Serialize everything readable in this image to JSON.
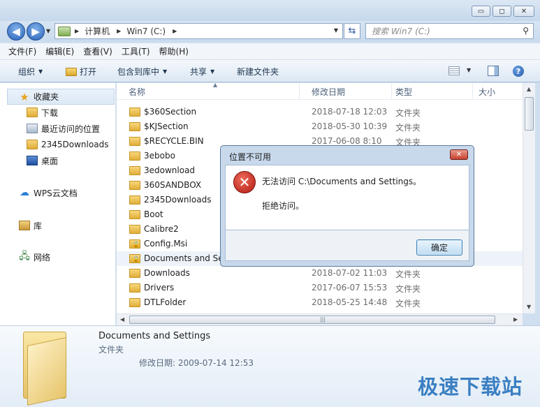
{
  "window": {
    "controls": {
      "minimize": "▭",
      "maximize": "◻",
      "close": "✕"
    }
  },
  "address": {
    "crumbs": [
      "计算机",
      "Win7 (C:)"
    ],
    "search_placeholder": "搜索 Win7 (C:)"
  },
  "menu": [
    "文件(F)",
    "编辑(E)",
    "查看(V)",
    "工具(T)",
    "帮助(H)"
  ],
  "commands": {
    "organize": "组织",
    "open": "打开",
    "include_library": "包含到库中",
    "share": "共享",
    "new_folder": "新建文件夹"
  },
  "sidebar": {
    "favorites": "收藏夹",
    "items": [
      "下载",
      "最近访问的位置",
      "2345Downloads",
      "桌面"
    ],
    "wps": "WPS云文档",
    "library": "库",
    "network": "网络"
  },
  "columns": {
    "name": "名称",
    "modified": "修改日期",
    "type": "类型",
    "size": "大小"
  },
  "files": [
    {
      "name": "$360Section",
      "date": "2018-07-18 12:03",
      "type": "文件夹"
    },
    {
      "name": "$KJSection",
      "date": "2018-05-30 10:39",
      "type": "文件夹"
    },
    {
      "name": "$RECYCLE.BIN",
      "date": "2017-06-08 8:10",
      "type": "文件夹"
    },
    {
      "name": "3ebobo",
      "date": "",
      "type": ""
    },
    {
      "name": "3edownload",
      "date": "",
      "type": ""
    },
    {
      "name": "360SANDBOX",
      "date": "",
      "type": ""
    },
    {
      "name": "2345Downloads",
      "date": "",
      "type": ""
    },
    {
      "name": "Boot",
      "date": "",
      "type": ""
    },
    {
      "name": "Calibre2",
      "date": "",
      "type": ""
    },
    {
      "name": "Config.Msi",
      "date": "",
      "type": ""
    },
    {
      "name": "Documents and Se",
      "date": "",
      "type": ""
    },
    {
      "name": "Downloads",
      "date": "2018-07-02 11:03",
      "type": "文件夹"
    },
    {
      "name": "Drivers",
      "date": "2017-06-07 15:53",
      "type": "文件夹"
    },
    {
      "name": "DTLFolder",
      "date": "2018-05-25 14:48",
      "type": "文件夹"
    }
  ],
  "details": {
    "name": "Documents and Settings",
    "type": "文件夹",
    "modified": "修改日期: 2009-07-14 12:53"
  },
  "dialog": {
    "title": "位置不可用",
    "message": "无法访问 C:\\Documents and Settings。",
    "detail": "拒绝访问。",
    "ok": "确定",
    "close": "✕"
  },
  "watermark": "极速下载站"
}
